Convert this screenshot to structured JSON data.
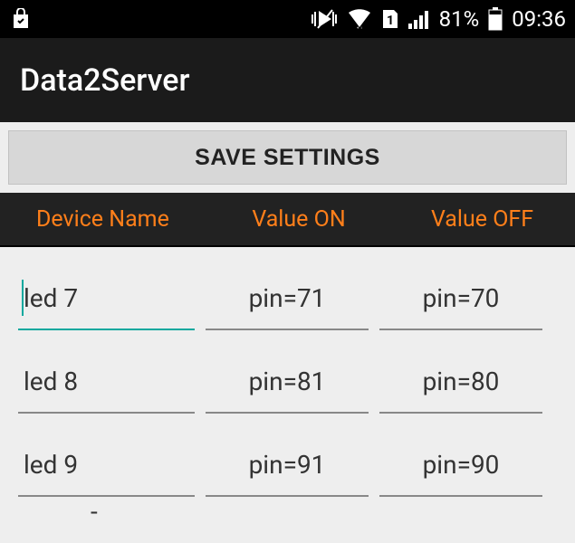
{
  "status_bar": {
    "battery_pct": "81%",
    "time": "09:36"
  },
  "app_bar": {
    "title": "Data2Server"
  },
  "buttons": {
    "save_label": "SAVE SETTINGS"
  },
  "table": {
    "headers": {
      "device_name": "Device Name",
      "value_on": "Value ON",
      "value_off": "Value OFF"
    },
    "rows": [
      {
        "device_name": "led 7",
        "value_on": "pin=71",
        "value_off": "pin=70",
        "focused": true
      },
      {
        "device_name": "led 8",
        "value_on": "pin=81",
        "value_off": "pin=80",
        "focused": false
      },
      {
        "device_name": "led 9",
        "value_on": "pin=91",
        "value_off": "pin=90",
        "focused": false
      },
      {
        "device_name": "-",
        "value_on": "",
        "value_off": "",
        "focused": false
      }
    ]
  }
}
